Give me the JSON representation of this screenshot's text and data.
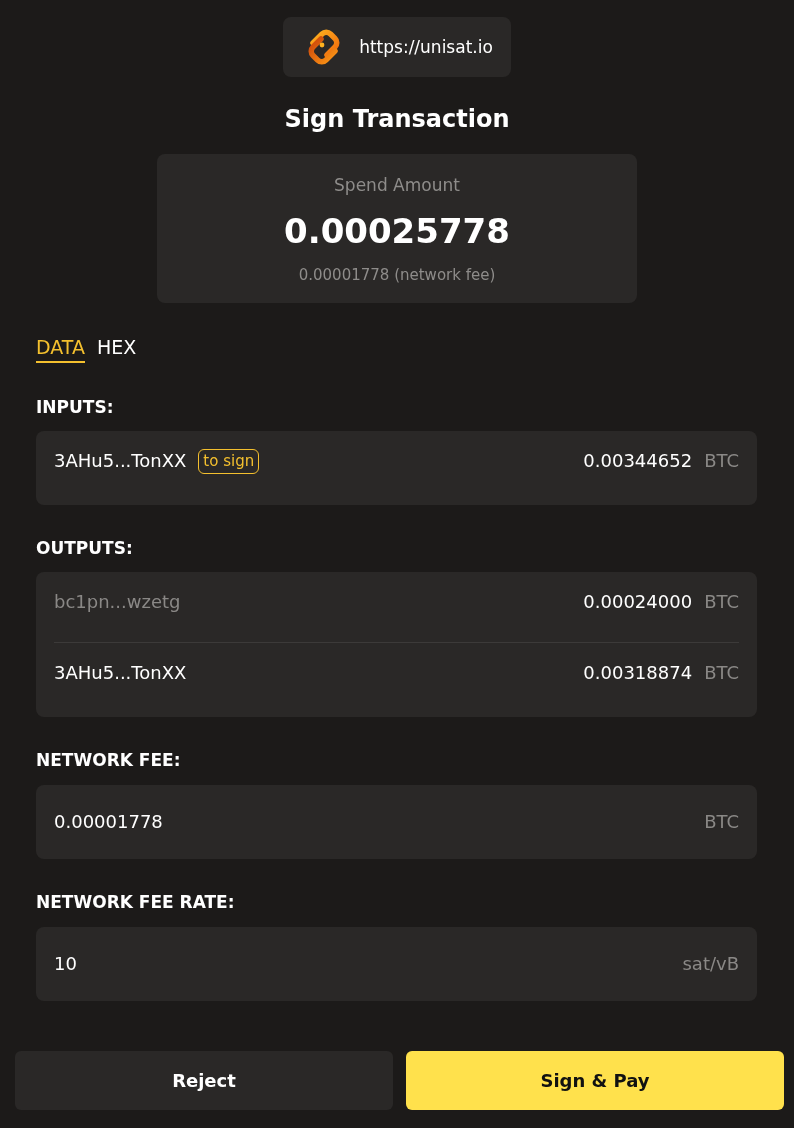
{
  "site": {
    "url": "https://unisat.io"
  },
  "title": "Sign Transaction",
  "spend": {
    "label": "Spend Amount",
    "amount": "0.00025778",
    "fee_note": "0.00001778 (network fee)"
  },
  "tabs": [
    {
      "label": "DATA",
      "selected": true
    },
    {
      "label": "HEX",
      "selected": false
    }
  ],
  "inputs": {
    "heading": "INPUTS:",
    "rows": [
      {
        "address": "3AHu5...TonXX",
        "badge": "to sign",
        "amount": "0.00344652",
        "unit": "BTC",
        "dimmed": false
      }
    ]
  },
  "outputs": {
    "heading": "OUTPUTS:",
    "rows": [
      {
        "address": "bc1pn...wzetg",
        "amount": "0.00024000",
        "unit": "BTC",
        "dimmed": true
      },
      {
        "address": "3AHu5...TonXX",
        "amount": "0.00318874",
        "unit": "BTC",
        "dimmed": false
      }
    ]
  },
  "network_fee": {
    "heading": "NETWORK FEE:",
    "value": "0.00001778",
    "unit": "BTC"
  },
  "fee_rate": {
    "heading": "NETWORK FEE RATE:",
    "value": "10",
    "unit": "sat/vB"
  },
  "buttons": [
    {
      "label": "Reject",
      "kind": "secondary"
    },
    {
      "label": "Sign & Pay",
      "kind": "primary"
    }
  ]
}
